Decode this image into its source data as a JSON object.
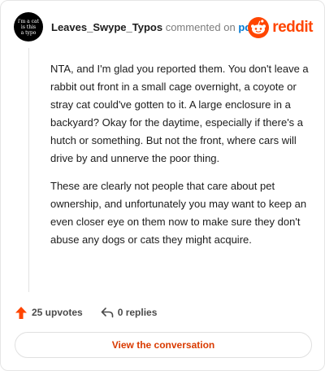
{
  "comment": {
    "avatar_text": [
      "i'm a cat",
      "is this",
      "a typo"
    ],
    "username": "Leaves_Swype_Typos",
    "action_text": "commented on",
    "post_link": "post",
    "brand_word": "reddit",
    "paragraphs": [
      "NTA, and I'm glad you reported them. You don't leave a rabbit out front in a small cage overnight, a coyote or stray cat could've gotten to it. A large enclosure in a backyard? Okay for the daytime, especially if there's a hutch or something. But not the front, where cars will drive by and unnerve the poor thing.",
      "These are clearly not people that care about pet ownership, and unfortunately you may want to keep an even closer eye on them now to make sure they don't abuse any dogs or cats they might acquire."
    ],
    "upvotes_label": "25 upvotes",
    "replies_label": "0 replies",
    "cta_label": "View the conversation"
  },
  "colors": {
    "brand": "#ff4500",
    "link": "#0079d3",
    "cta_text": "#d93a00"
  },
  "icons": {
    "brand": "reddit-logo-icon",
    "upvote": "upvote-arrow-icon",
    "reply": "reply-arrow-icon"
  }
}
